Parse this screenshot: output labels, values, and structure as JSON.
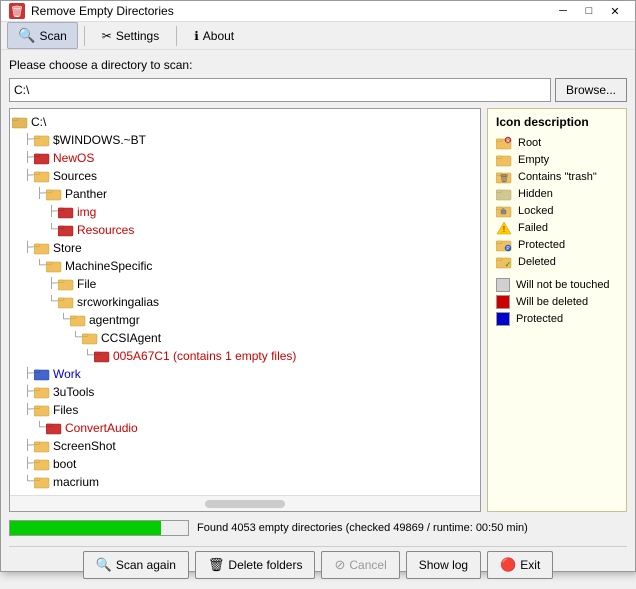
{
  "window": {
    "title": "Remove Empty Directories",
    "icon": "🗑"
  },
  "toolbar": {
    "scan_label": "Scan",
    "settings_label": "Settings",
    "about_label": "About"
  },
  "directory": {
    "label": "Please choose a directory to scan:",
    "value": "C:\\",
    "browse_label": "Browse..."
  },
  "tree": {
    "root": "C:\\"
  },
  "tree_items": [
    {
      "indent": 0,
      "label": "C:\\",
      "type": "normal",
      "connector": ""
    },
    {
      "indent": 1,
      "label": "$WINDOWS.~BT",
      "type": "normal",
      "connector": "├"
    },
    {
      "indent": 1,
      "label": "NewOS",
      "type": "red",
      "connector": "├"
    },
    {
      "indent": 1,
      "label": "Sources",
      "type": "normal",
      "connector": "├"
    },
    {
      "indent": 2,
      "label": "Panther",
      "type": "normal",
      "connector": "├"
    },
    {
      "indent": 3,
      "label": "img",
      "type": "red",
      "connector": "├"
    },
    {
      "indent": 3,
      "label": "Resources",
      "type": "red",
      "connector": "└"
    },
    {
      "indent": 1,
      "label": "Store",
      "type": "normal",
      "connector": "├"
    },
    {
      "indent": 2,
      "label": "MachineSpecific",
      "type": "normal",
      "connector": "└"
    },
    {
      "indent": 3,
      "label": "File",
      "type": "normal",
      "connector": "├"
    },
    {
      "indent": 3,
      "label": "srcworkingalias",
      "type": "normal",
      "connector": "└"
    },
    {
      "indent": 4,
      "label": "agentmgr",
      "type": "normal",
      "connector": "└"
    },
    {
      "indent": 5,
      "label": "CCSIAgent",
      "type": "normal",
      "connector": "└"
    },
    {
      "indent": 6,
      "label": "005A67C1 (contains 1 empty files)",
      "type": "red-label",
      "connector": "└"
    },
    {
      "indent": 1,
      "label": "Work",
      "type": "blue",
      "connector": "├"
    },
    {
      "indent": 1,
      "label": "3uTools",
      "type": "normal",
      "connector": "├"
    },
    {
      "indent": 1,
      "label": "Files",
      "type": "normal",
      "connector": "├"
    },
    {
      "indent": 2,
      "label": "ConvertAudio",
      "type": "red",
      "connector": "└"
    },
    {
      "indent": 1,
      "label": "ScreenShot",
      "type": "normal",
      "connector": "├"
    },
    {
      "indent": 1,
      "label": "boot",
      "type": "normal",
      "connector": "├"
    },
    {
      "indent": 1,
      "label": "macrium",
      "type": "normal",
      "connector": "└"
    }
  ],
  "icon_legend": {
    "title": "Icon description",
    "items": [
      {
        "icon": "root",
        "label": "Root"
      },
      {
        "icon": "empty",
        "label": "Empty"
      },
      {
        "icon": "trash",
        "label": "Contains \"trash\""
      },
      {
        "icon": "hidden",
        "label": "Hidden"
      },
      {
        "icon": "locked",
        "label": "Locked"
      },
      {
        "icon": "failed",
        "label": "Failed"
      },
      {
        "icon": "protected",
        "label": "Protected"
      },
      {
        "icon": "deleted",
        "label": "Deleted"
      }
    ],
    "color_legend": [
      {
        "color": "#d0d0d0",
        "label": "Will not be touched"
      },
      {
        "color": "#cc0000",
        "label": "Will be deleted"
      },
      {
        "color": "#0000cc",
        "label": "Protected"
      }
    ]
  },
  "progress": {
    "percent": 85,
    "text": "Found 4053 empty directories (checked 49869 / runtime: 00:50 min)"
  },
  "actions": {
    "scan_again": "Scan again",
    "delete_folders": "Delete folders",
    "cancel": "Cancel",
    "show_log": "Show log",
    "exit": "Exit"
  }
}
